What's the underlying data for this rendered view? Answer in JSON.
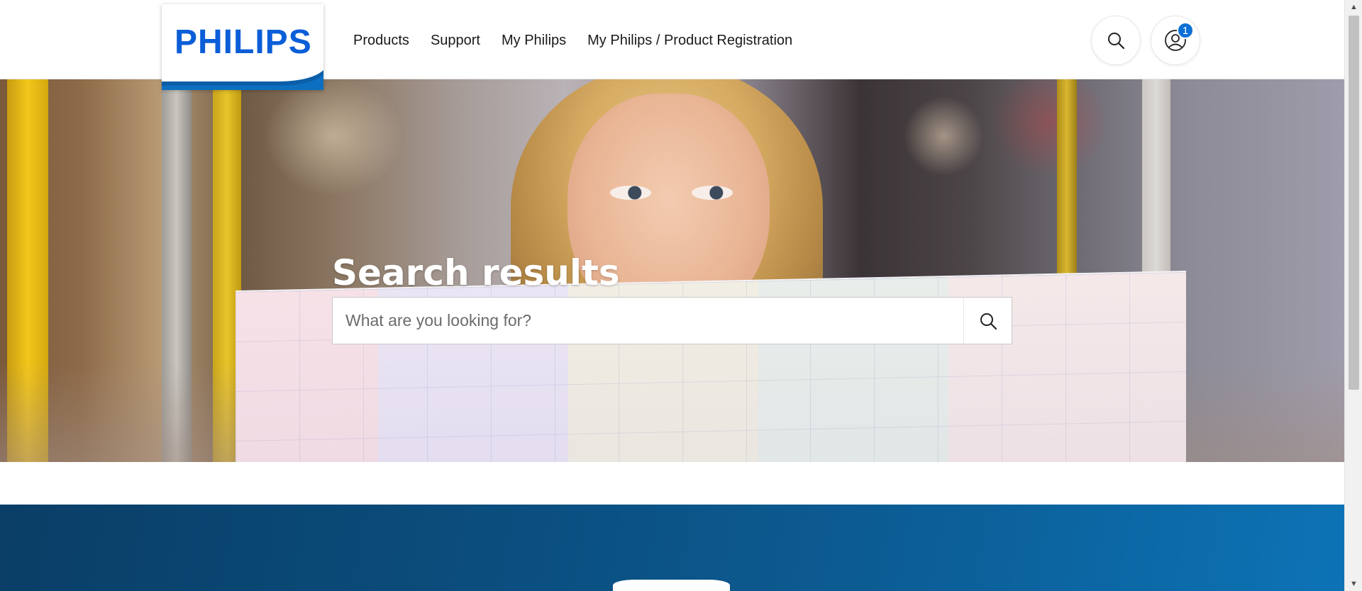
{
  "header": {
    "logo_text": "PHILIPS",
    "brand_color": "#0b5ed7",
    "nav_items": [
      {
        "label": "Products"
      },
      {
        "label": "Support"
      },
      {
        "label": "My Philips"
      },
      {
        "label": "My Philips / Product Registration"
      }
    ],
    "search_icon": "search-icon",
    "account_icon": "user-account-icon",
    "account_badge": "1",
    "badge_color": "#0b6fd6"
  },
  "hero": {
    "title": "Search results",
    "search": {
      "placeholder": "What are you looking for?",
      "value": "",
      "submit_icon": "search-icon"
    }
  },
  "band": {
    "color": "#0b4f80"
  },
  "scrollbar": {
    "up_icon": "scroll-up-arrow-icon",
    "down_icon": "scroll-down-arrow-icon"
  }
}
